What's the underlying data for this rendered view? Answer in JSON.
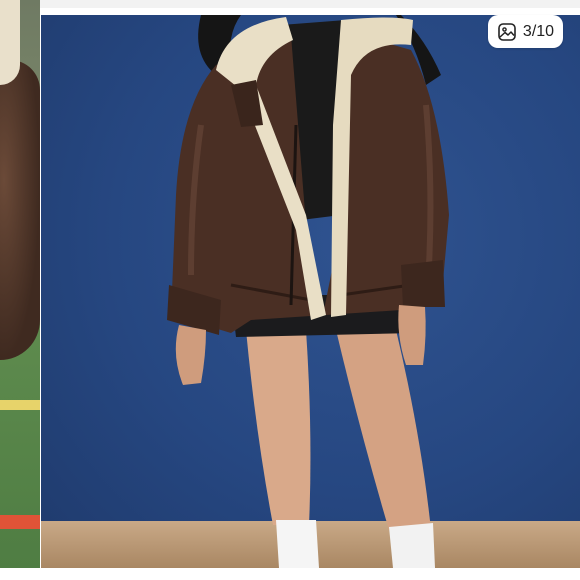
{
  "gallery": {
    "counter": {
      "current": 3,
      "total": 10,
      "text": "3/10"
    },
    "counter_icon": "image-gallery-icon",
    "colors": {
      "backdrop_blue": "#264781",
      "floor": "#b8956f",
      "jacket_brown": "#4a2f24",
      "sherpa_cream": "#e9dfc6",
      "badge_bg": "#ffffff",
      "badge_text": "#222222"
    }
  }
}
